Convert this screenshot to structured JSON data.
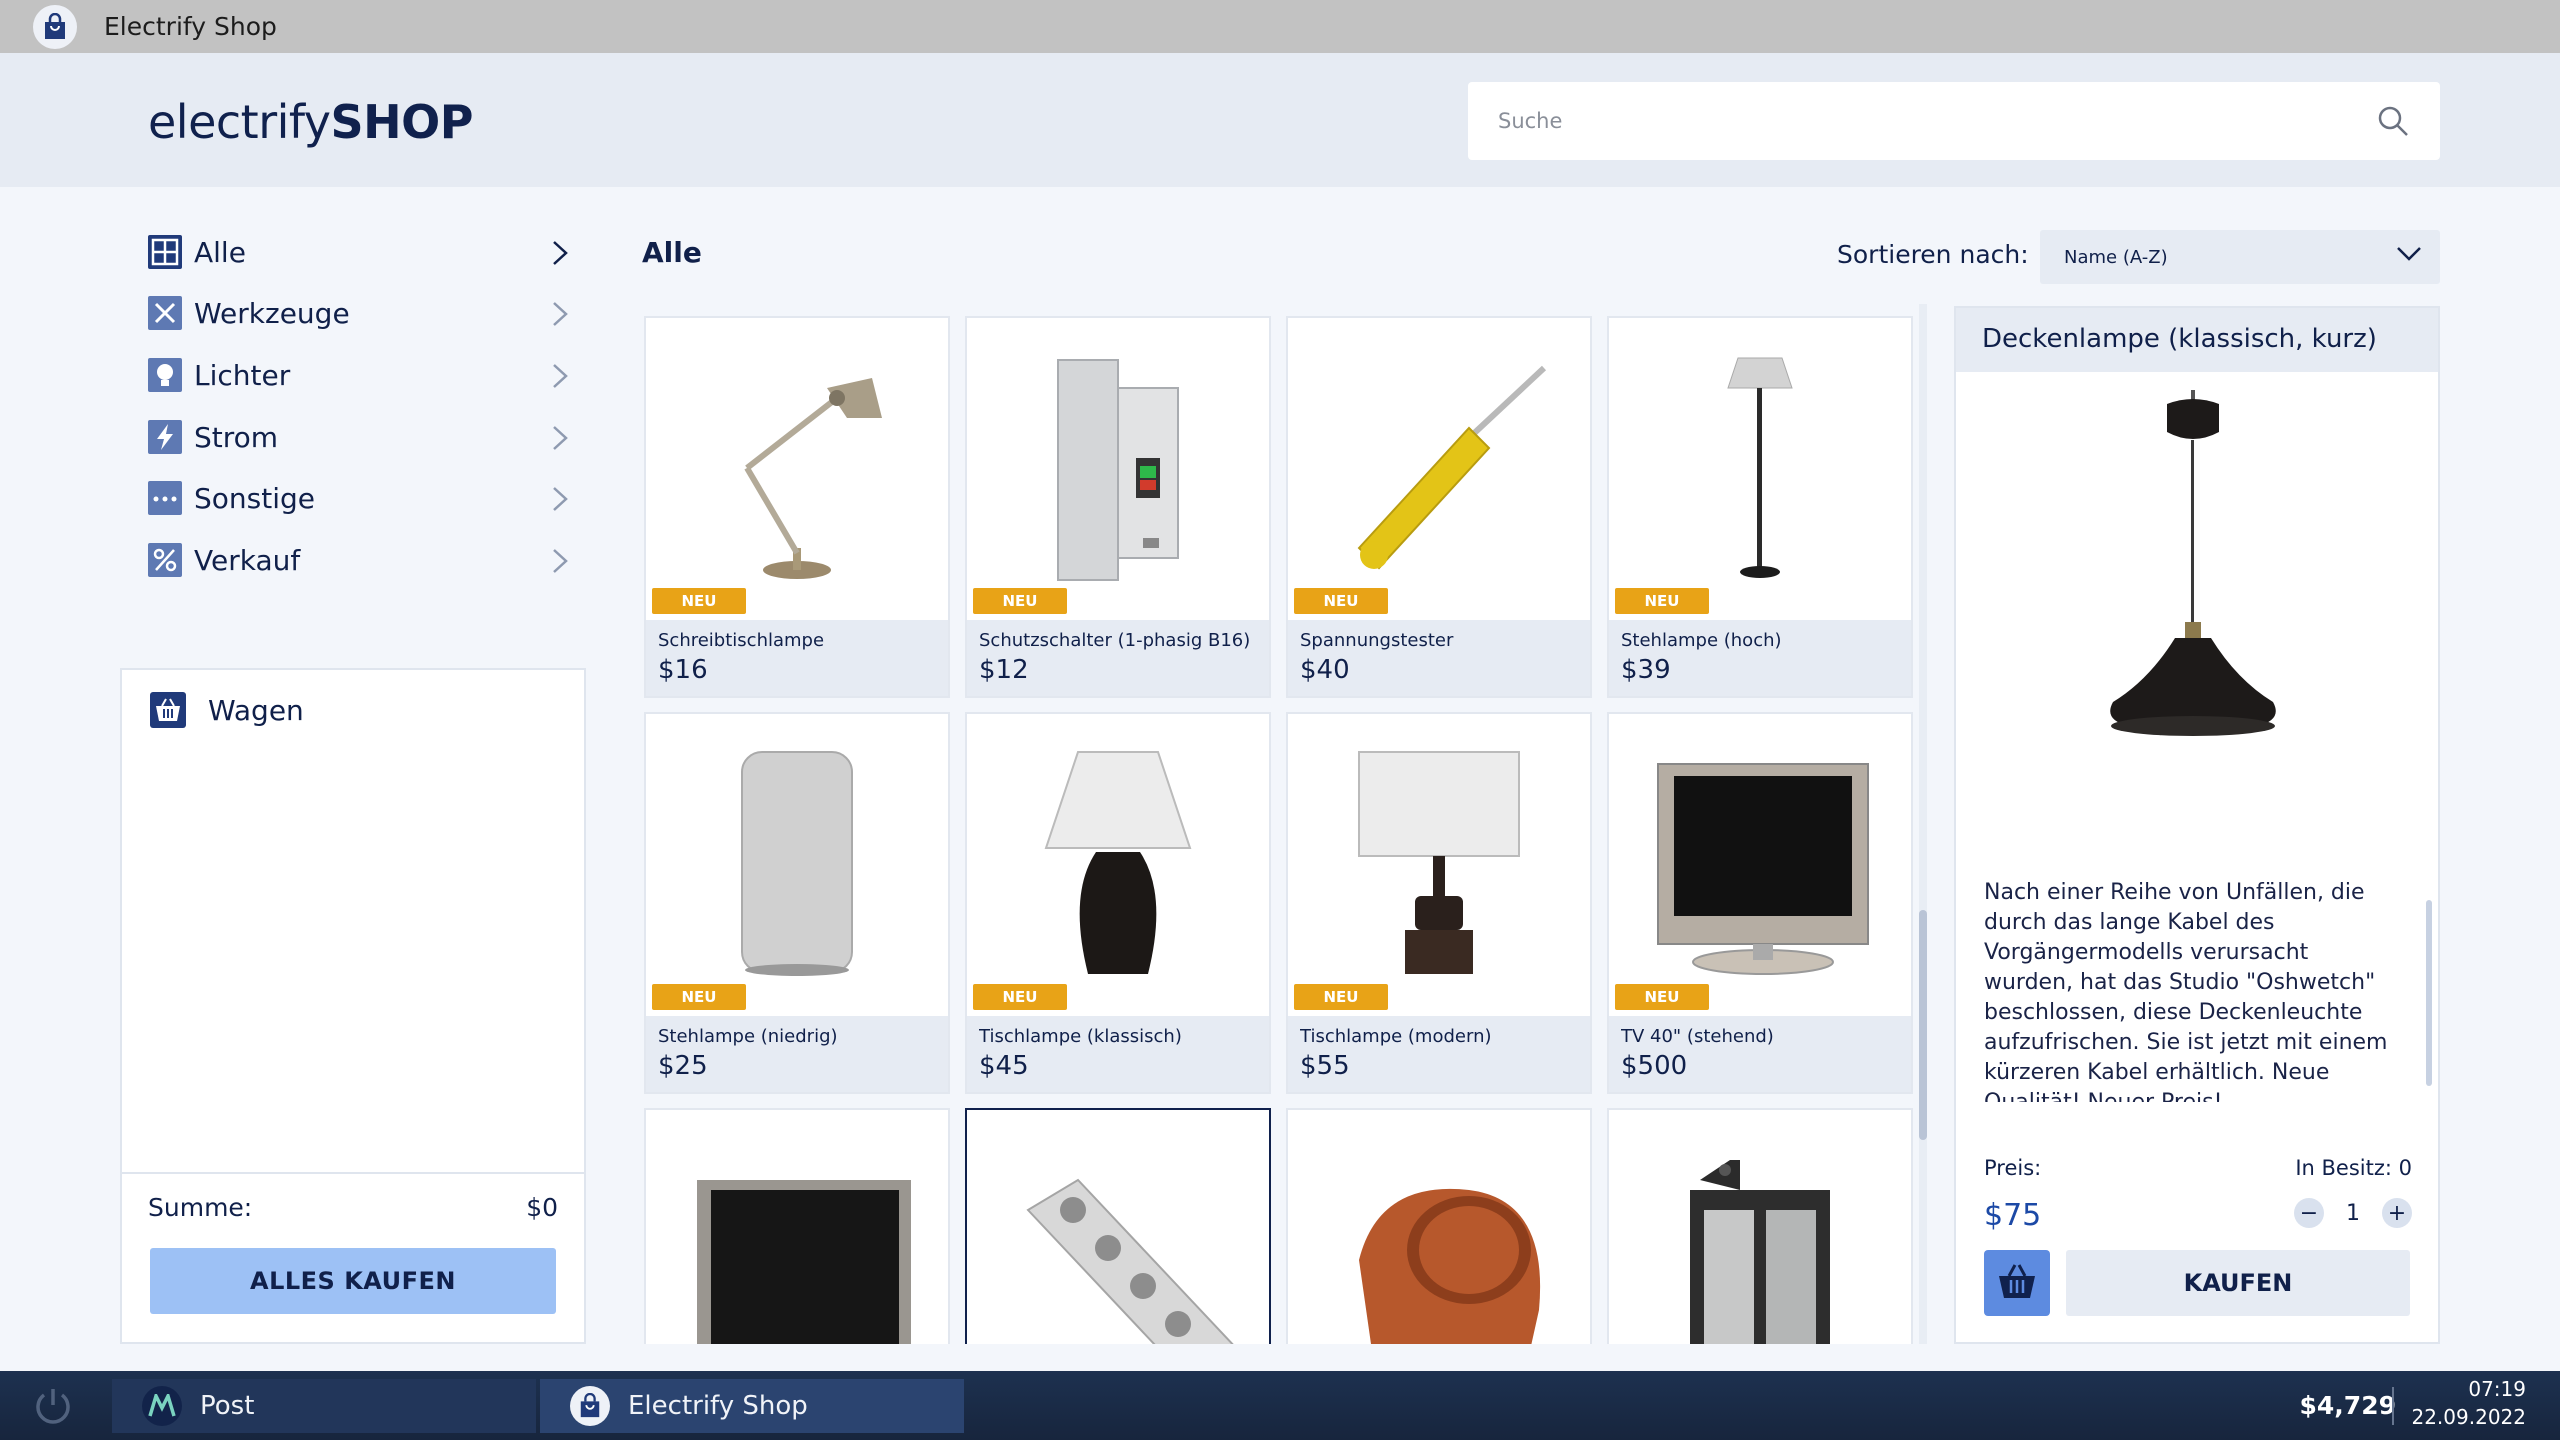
{
  "window": {
    "title": "Electrify Shop"
  },
  "header": {
    "logo_light": "electrify",
    "logo_bold": "SHOP",
    "search_placeholder": "Suche"
  },
  "sidebar": {
    "items": [
      {
        "label": "Alle",
        "icon": "grid-icon"
      },
      {
        "label": "Werkzeuge",
        "icon": "tools-icon"
      },
      {
        "label": "Lichter",
        "icon": "bulb-icon"
      },
      {
        "label": "Strom",
        "icon": "lightning-icon"
      },
      {
        "label": "Sonstige",
        "icon": "dots-icon"
      },
      {
        "label": "Verkauf",
        "icon": "percent-icon"
      }
    ]
  },
  "cart": {
    "title": "Wagen",
    "sum_label": "Summe:",
    "sum_value": "$0",
    "buy_all_label": "ALLES KAUFEN"
  },
  "main": {
    "title": "Alle",
    "sort_label": "Sortieren nach:",
    "sort_value": "Name (A-Z)"
  },
  "products": [
    {
      "name": "Schreibtischlampe",
      "price": "$16",
      "badge": "NEU"
    },
    {
      "name": "Schutzschalter (1-phasig B16)",
      "price": "$12",
      "badge": "NEU"
    },
    {
      "name": "Spannungstester",
      "price": "$40",
      "badge": "NEU"
    },
    {
      "name": "Stehlampe (hoch)",
      "price": "$39",
      "badge": "NEU"
    },
    {
      "name": "Stehlampe (niedrig)",
      "price": "$25",
      "badge": "NEU"
    },
    {
      "name": "Tischlampe (klassisch)",
      "price": "$45",
      "badge": "NEU"
    },
    {
      "name": "Tischlampe (modern)",
      "price": "$55",
      "badge": "NEU"
    },
    {
      "name": "TV 40\" (stehend)",
      "price": "$500",
      "badge": "NEU"
    }
  ],
  "detail": {
    "title": "Deckenlampe (klassisch, kurz)",
    "description": "Nach einer Reihe von Unfällen, die durch das lange Kabel des Vorgängermodells verursacht wurden, hat das Studio \"Oshwetch\" beschlossen, diese Deckenleuchte aufzufrischen. Sie ist jetzt mit einem kürzeren Kabel erhältlich. Neue Qualität! Neuer Preis!",
    "price_label": "Preis:",
    "price": "$75",
    "owned_label": "In Besitz: 0",
    "quantity": "1",
    "buy_label": "KAUFEN"
  },
  "taskbar": {
    "apps": [
      {
        "label": "Post"
      },
      {
        "label": "Electrify Shop"
      }
    ],
    "balance": "$4,729",
    "time": "07:19",
    "date": "22.09.2022"
  },
  "colors": {
    "brand_navy": "#10214d",
    "badge_orange": "#e8a317",
    "buy_all_blue": "#9dc1f5",
    "price_blue": "#1c49a6"
  }
}
